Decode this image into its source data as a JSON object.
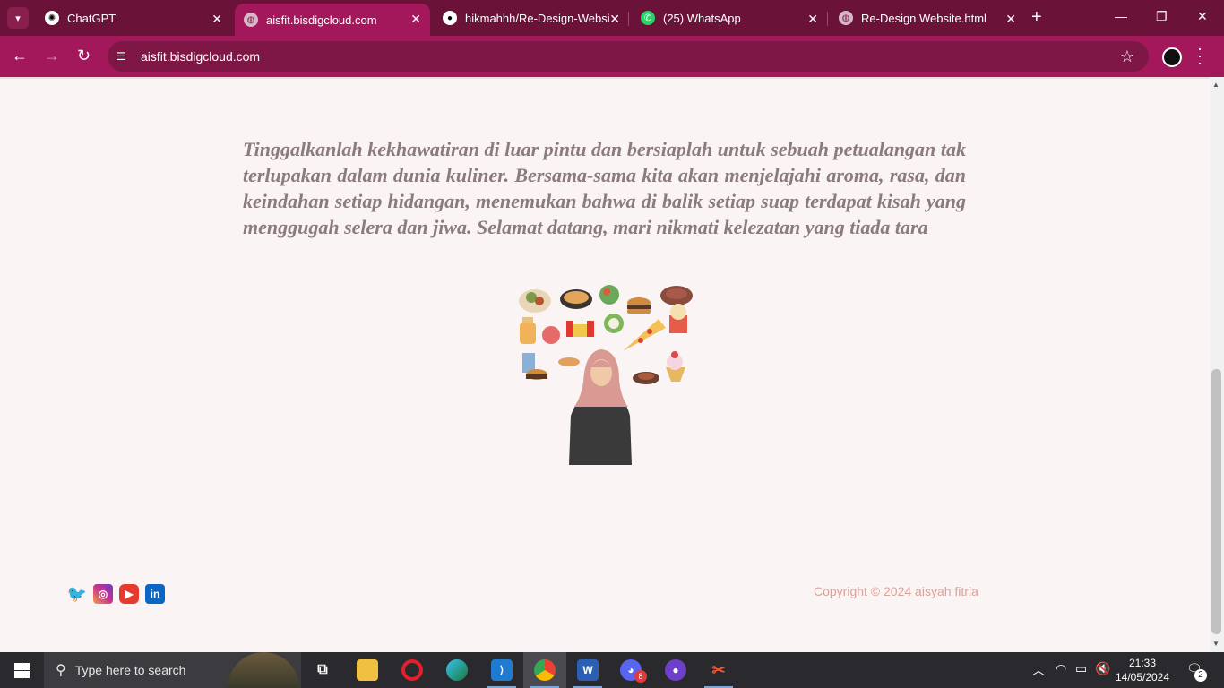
{
  "browser": {
    "tabs": [
      {
        "title": "ChatGPT",
        "icon": "chatgpt-icon"
      },
      {
        "title": "aisfit.bisdigcloud.com",
        "icon": "globe-icon",
        "active": true
      },
      {
        "title": "hikmahhh/Re-Design-Websi",
        "icon": "github-icon"
      },
      {
        "title": "(25) WhatsApp",
        "icon": "whatsapp-icon"
      },
      {
        "title": "Re-Design Website.html",
        "icon": "globe-icon"
      }
    ],
    "url": "aisfit.bisdigcloud.com",
    "theme_color": "#a3185b"
  },
  "page": {
    "paragraph": "Tinggalkanlah kekhawatiran di luar pintu dan bersiaplah untuk sebuah petualangan tak terlupakan dalam dunia kuliner. Bersama-sama kita akan menjelajahi aroma, rasa, dan keindahan setiap hidangan, menemukan bahwa di balik setiap suap terdapat kisah yang menggugah selera dan jiwa. Selamat datang, mari nikmati kelezatan yang tiada tara",
    "social_icons": [
      "twitter-icon",
      "instagram-icon",
      "youtube-icon",
      "linkedin-icon"
    ],
    "copyright": "Copyright © 2024 aisyah fitria"
  },
  "taskbar": {
    "search_placeholder": "Type here to search",
    "time": "21:33",
    "date": "14/05/2024",
    "notification_count": "2",
    "discord_badge": "8"
  }
}
